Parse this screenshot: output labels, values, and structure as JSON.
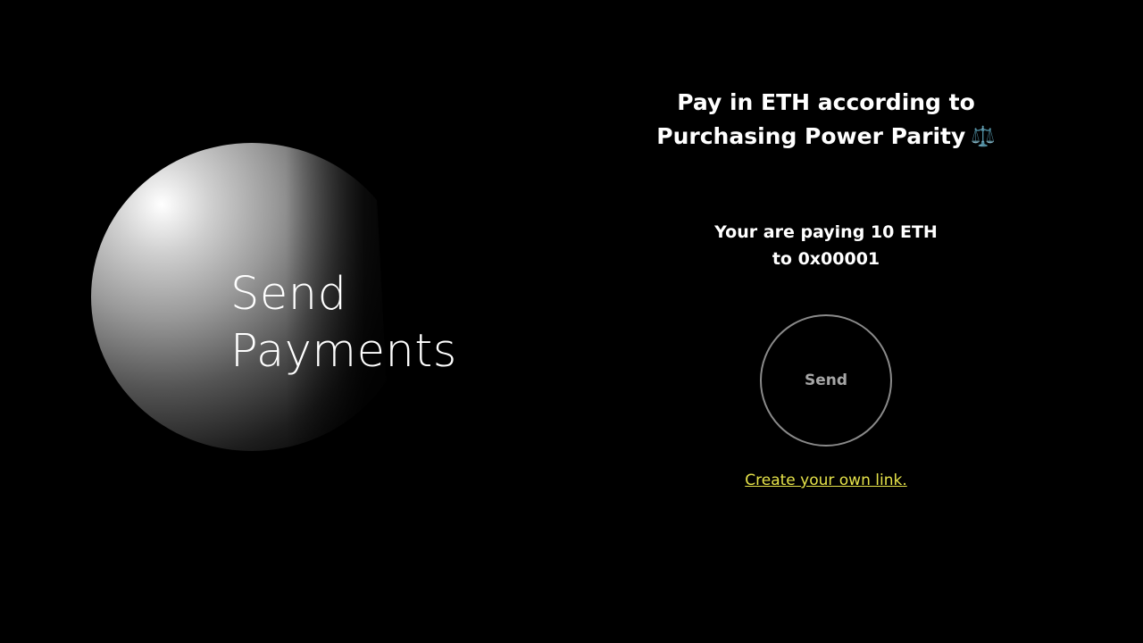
{
  "hero": {
    "line1": "Send",
    "line2": "Payments"
  },
  "panel": {
    "title_line1": "Pay in ETH according to",
    "title_line2": "Purchasing Power Parity",
    "title_icon": "⚖️",
    "paying_line1": "Your are paying 10 ETH",
    "paying_line2": "to 0x00001",
    "send_label": "Send",
    "link_label": "Create your own link."
  },
  "colors": {
    "background": "#000000",
    "text": "#ffffff",
    "button_border": "#8a8a8a",
    "button_text": "#a6a6a6",
    "link": "#e6e34a"
  },
  "icons": {
    "title_icon": "scales-icon"
  }
}
